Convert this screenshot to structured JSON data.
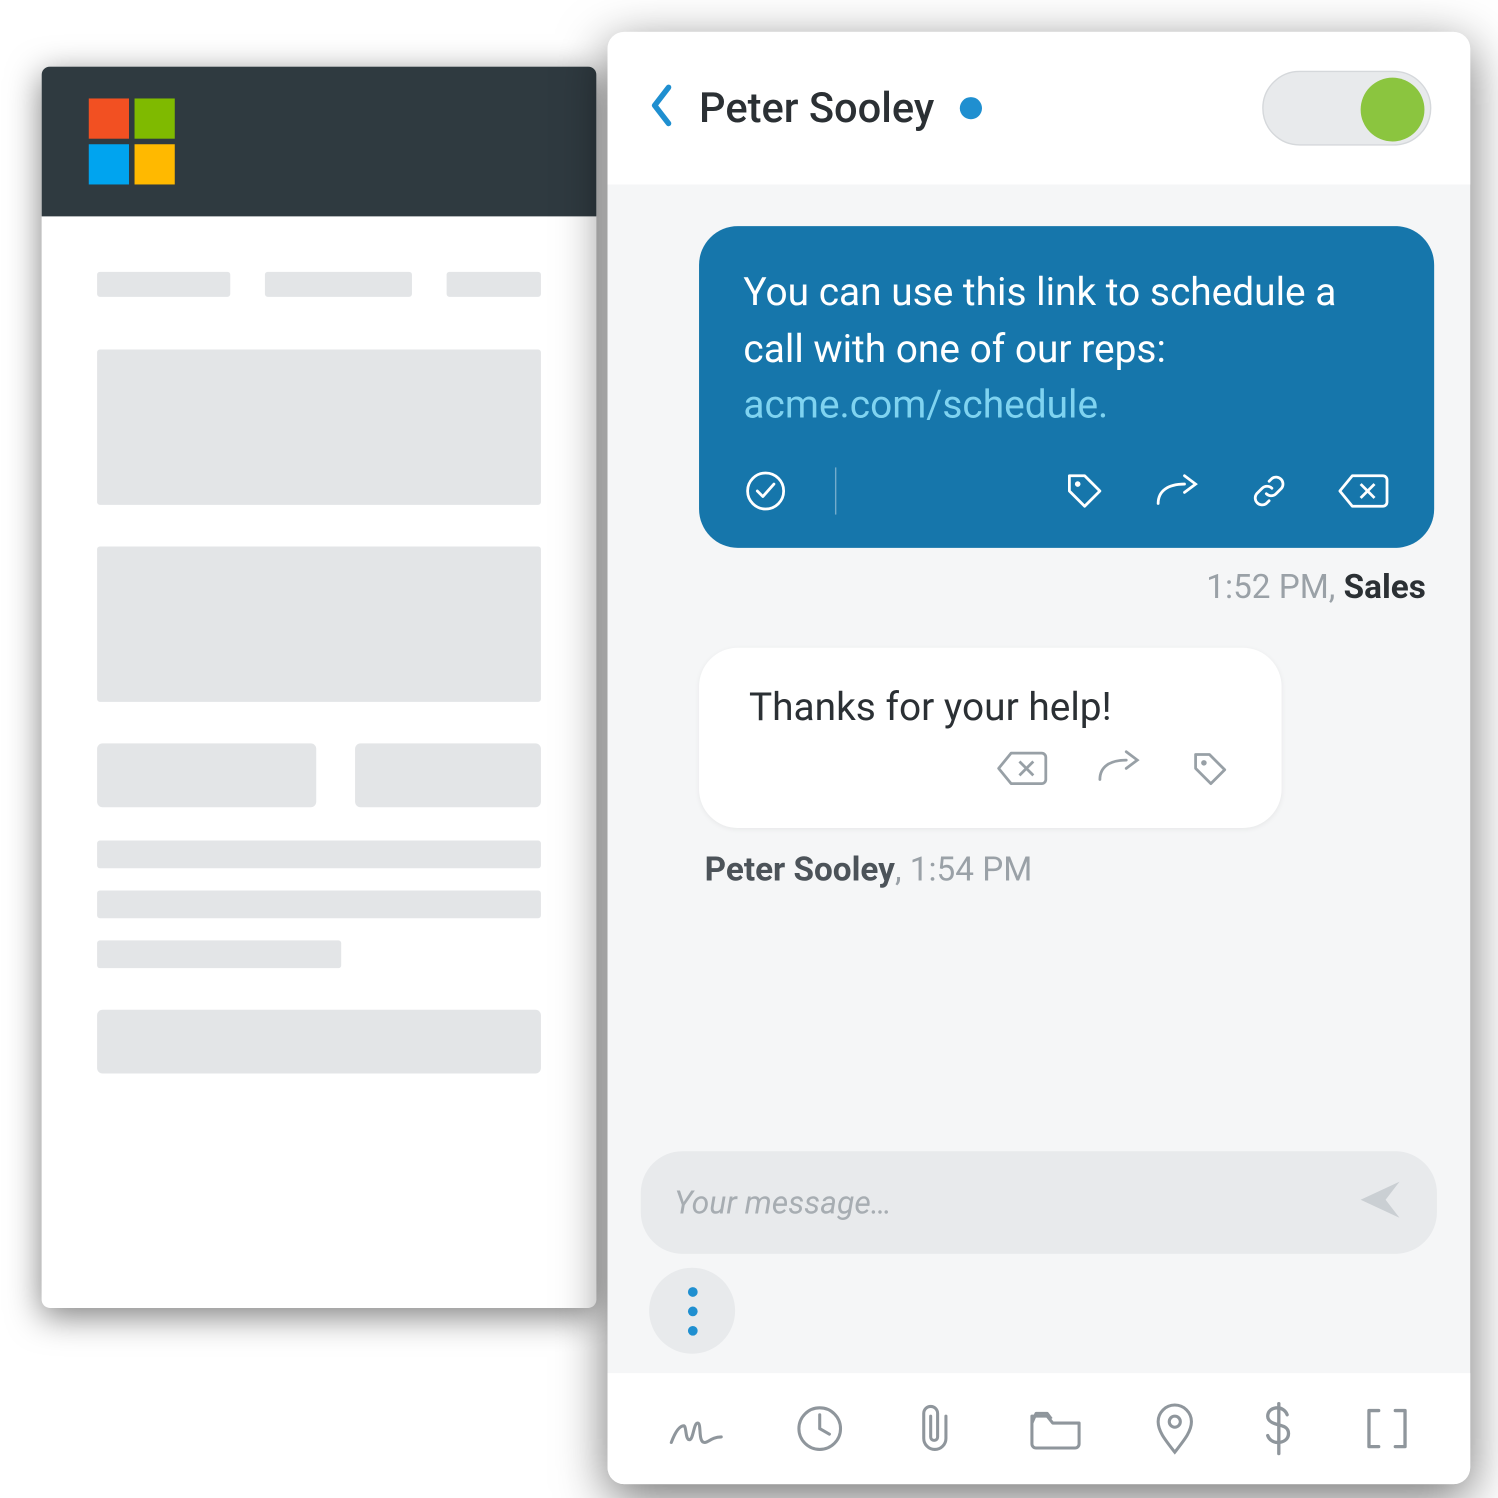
{
  "header": {
    "contact_name": "Peter Sooley",
    "status": "online",
    "toggle_on": true
  },
  "messages": {
    "outgoing": {
      "text_pre": "You can use this link to schedule a call with one of our reps: ",
      "link_text": "acme.com/schedule.",
      "timestamp": "1:52 PM",
      "sender": "Sales"
    },
    "incoming": {
      "text": "Thanks for your help!",
      "sender": "Peter Sooley",
      "timestamp": "1:54 PM"
    }
  },
  "composer": {
    "placeholder": "Your message…"
  },
  "toolbar": {
    "items": [
      "signature",
      "schedule",
      "attachment",
      "templates",
      "location",
      "payment",
      "merge-field"
    ]
  },
  "out_actions": [
    "confirm",
    "tag",
    "forward",
    "link",
    "delete"
  ],
  "in_actions": [
    "delete",
    "forward",
    "tag"
  ]
}
